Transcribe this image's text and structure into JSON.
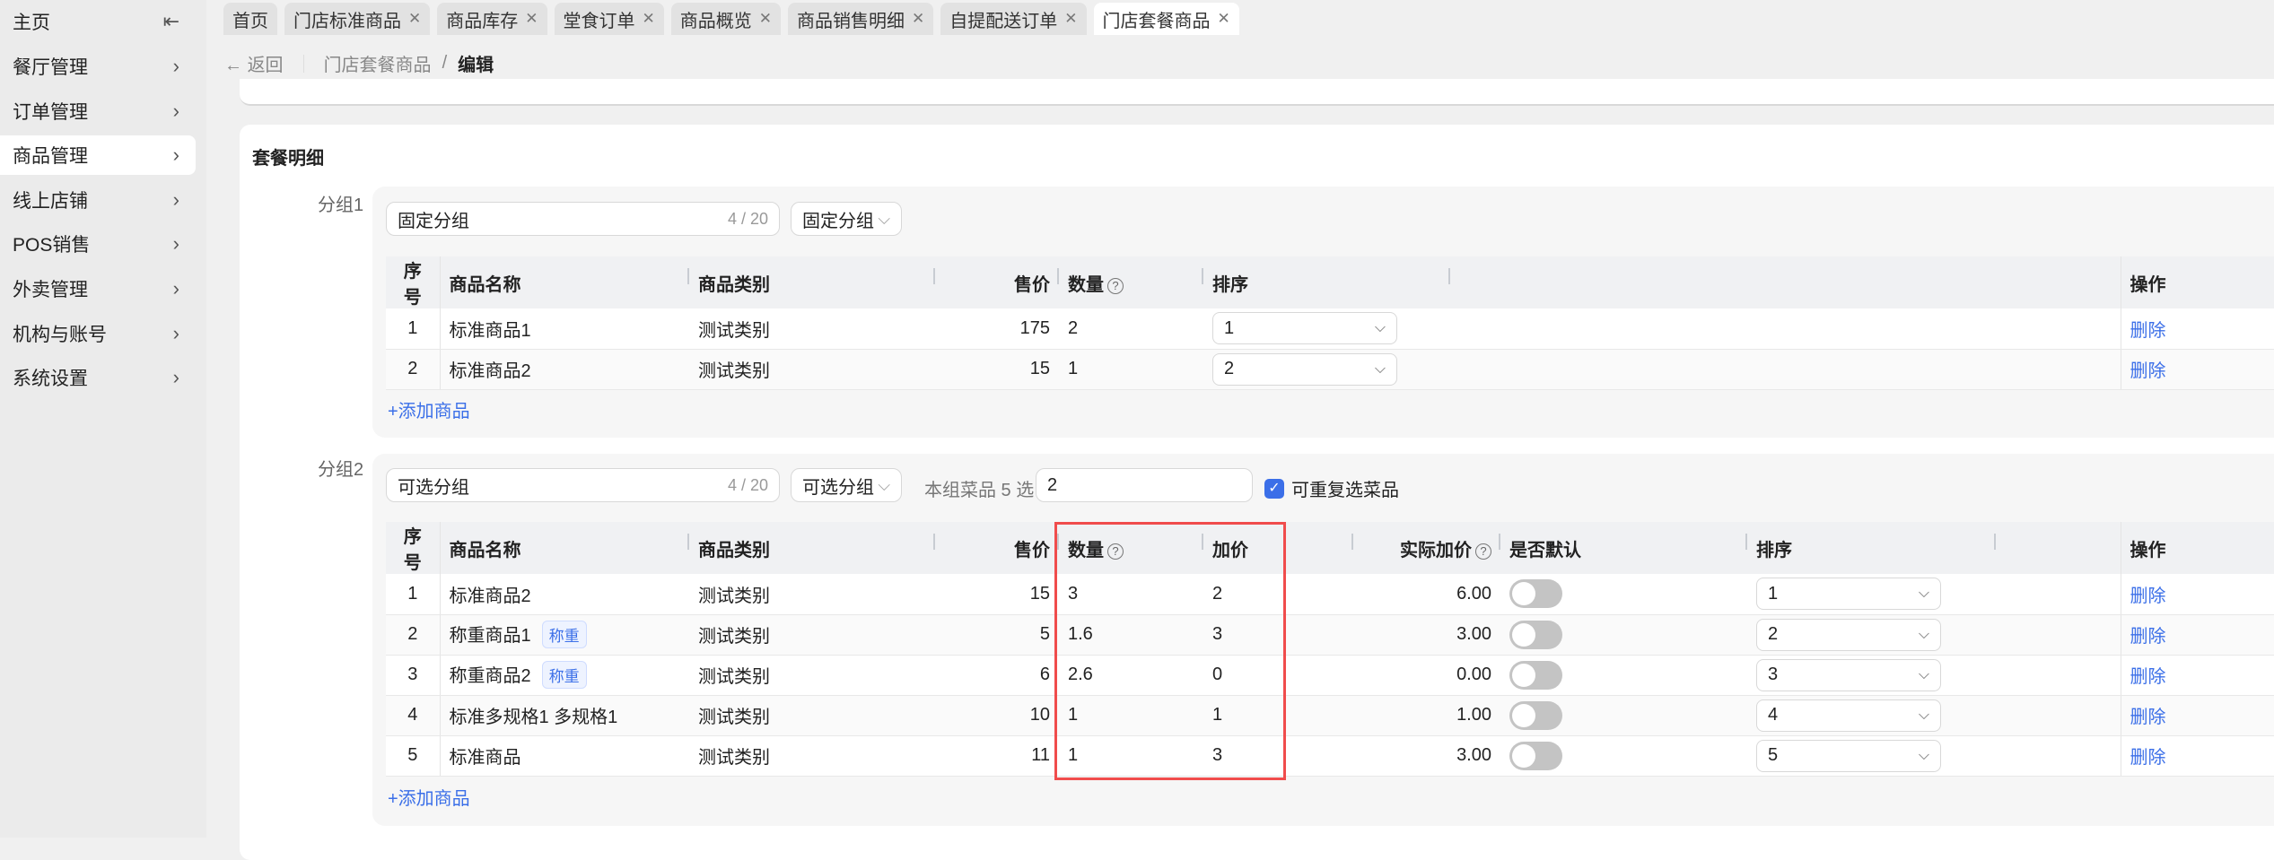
{
  "sidebar": {
    "home": "主页",
    "collapse_icon": "collapse-left-icon",
    "items": [
      {
        "label": "餐厅管理"
      },
      {
        "label": "订单管理"
      },
      {
        "label": "商品管理",
        "active": true
      },
      {
        "label": "线上店铺"
      },
      {
        "label": "POS销售"
      },
      {
        "label": "外卖管理"
      },
      {
        "label": "机构与账号"
      },
      {
        "label": "系统设置"
      }
    ]
  },
  "tabs": [
    {
      "label": "首页",
      "closable": false
    },
    {
      "label": "门店标准商品",
      "closable": true
    },
    {
      "label": "商品库存",
      "closable": true
    },
    {
      "label": "堂食订单",
      "closable": true
    },
    {
      "label": "商品概览",
      "closable": true
    },
    {
      "label": "商品销售明细",
      "closable": true
    },
    {
      "label": "自提配送订单",
      "closable": true
    },
    {
      "label": "门店套餐商品",
      "closable": true,
      "active": true
    }
  ],
  "breadcrumb": {
    "back": "返回",
    "parent": "门店套餐商品",
    "sep": "/",
    "current": "编辑"
  },
  "section_title": "套餐明细",
  "group1": {
    "label": "分组1",
    "name": "固定分组",
    "count": "4 / 20",
    "type": "固定分组",
    "add": "+添加商品",
    "headers": {
      "no": "序号",
      "name": "商品名称",
      "category": "商品类别",
      "price": "售价",
      "qty": "数量",
      "sort": "排序",
      "op": "操作"
    },
    "rows": [
      {
        "no": "1",
        "name": "标准商品1",
        "category": "测试类别",
        "price": "175",
        "qty": "2",
        "sort": "1",
        "op": "删除"
      },
      {
        "no": "2",
        "name": "标准商品2",
        "category": "测试类别",
        "price": "15",
        "qty": "1",
        "sort": "2",
        "op": "删除"
      }
    ]
  },
  "group2": {
    "label": "分组2",
    "name": "可选分组",
    "count": "4 / 20",
    "type": "可选分组",
    "pick_label": "本组菜品 5 选",
    "pick_value": "2",
    "repeat_label": "可重复选菜品",
    "repeat_checked": true,
    "add": "+添加商品",
    "headers": {
      "no": "序号",
      "name": "商品名称",
      "category": "商品类别",
      "price": "售价",
      "qty": "数量",
      "markup": "加价",
      "actual": "实际加价",
      "default": "是否默认",
      "sort": "排序",
      "op": "操作"
    },
    "rows": [
      {
        "no": "1",
        "name": "标准商品2",
        "tag": "",
        "category": "测试类别",
        "price": "15",
        "qty": "3",
        "markup": "2",
        "actual": "6.00",
        "default": false,
        "sort": "1",
        "op": "删除"
      },
      {
        "no": "2",
        "name": "称重商品1",
        "tag": "称重",
        "category": "测试类别",
        "price": "5",
        "qty": "1.6",
        "markup": "3",
        "actual": "3.00",
        "default": false,
        "sort": "2",
        "op": "删除"
      },
      {
        "no": "3",
        "name": "称重商品2",
        "tag": "称重",
        "category": "测试类别",
        "price": "6",
        "qty": "2.6",
        "markup": "0",
        "actual": "0.00",
        "default": false,
        "sort": "3",
        "op": "删除"
      },
      {
        "no": "4",
        "name": "标准多规格1  多规格1",
        "tag": "",
        "category": "测试类别",
        "price": "10",
        "qty": "1",
        "markup": "1",
        "actual": "1.00",
        "default": false,
        "sort": "4",
        "op": "删除"
      },
      {
        "no": "5",
        "name": "标准商品",
        "tag": "",
        "category": "测试类别",
        "price": "11",
        "qty": "1",
        "markup": "3",
        "actual": "3.00",
        "default": false,
        "sort": "5",
        "op": "删除"
      }
    ]
  },
  "colors": {
    "accent": "#3b6fe8",
    "highlight": "#f04c4c"
  }
}
